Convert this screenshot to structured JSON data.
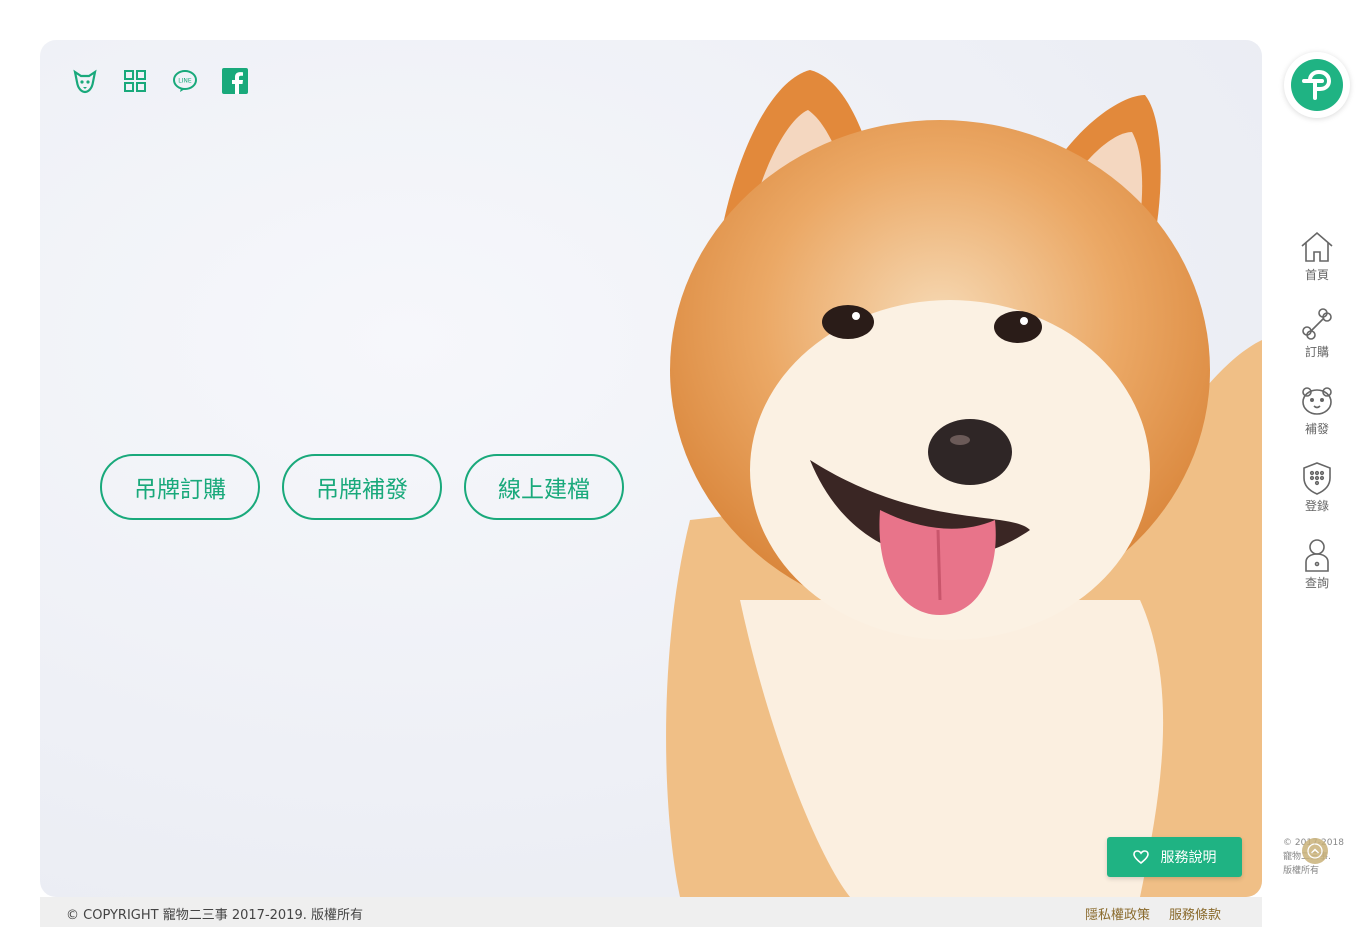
{
  "social": {
    "icons": [
      "dog-face-icon",
      "qr-code-icon",
      "line-icon",
      "facebook-icon"
    ],
    "line_text": "LINE"
  },
  "cta": {
    "order": "吊牌訂購",
    "reissue": "吊牌補發",
    "register": "線上建檔"
  },
  "service_button": {
    "label": "服務說明",
    "icon": "heart-icon"
  },
  "footer": {
    "copyright": "© COPYRIGHT 寵物二三事 2017-2019. 版權所有",
    "privacy": "隱私權政策",
    "terms": "服務條款"
  },
  "sidebar": {
    "logo_icon": "brand-logo-icon",
    "items": [
      {
        "label": "首頁",
        "icon": "home-icon"
      },
      {
        "label": "訂購",
        "icon": "bone-icon"
      },
      {
        "label": "補發",
        "icon": "bear-icon"
      },
      {
        "label": "登錄",
        "icon": "shield-icon"
      },
      {
        "label": "查詢",
        "icon": "person-icon"
      }
    ],
    "copyright_lines": [
      "© 2017-2018",
      "寵物二三事.",
      "版權所有"
    ]
  },
  "colors": {
    "accent": "#1fb383",
    "link": "#8a6a2c"
  }
}
